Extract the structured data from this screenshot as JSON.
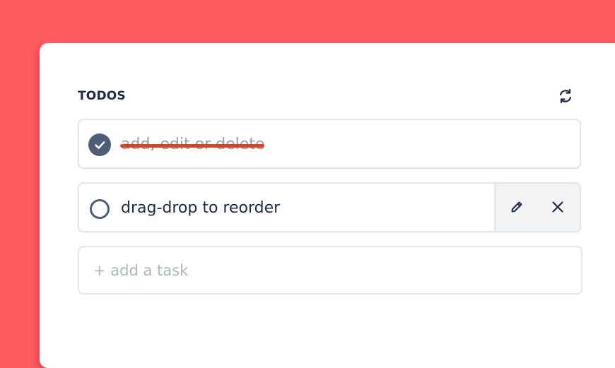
{
  "header": {
    "title": "TODOS",
    "refresh_icon": "refresh-icon"
  },
  "tasks": [
    {
      "text": "add, edit or delete",
      "completed": true
    },
    {
      "text": "drag-drop to reorder",
      "completed": false
    }
  ],
  "task_actions": {
    "edit_icon": "pencil-icon",
    "delete_icon": "close-icon"
  },
  "new_task": {
    "placeholder": "+ add a task",
    "value": ""
  },
  "colors": {
    "background": "#ff5b61",
    "card": "#ffffff",
    "text": "#1e2b45",
    "check": "#4e5d78",
    "strike": "#d0462a",
    "placeholder": "#b0b5bd"
  }
}
